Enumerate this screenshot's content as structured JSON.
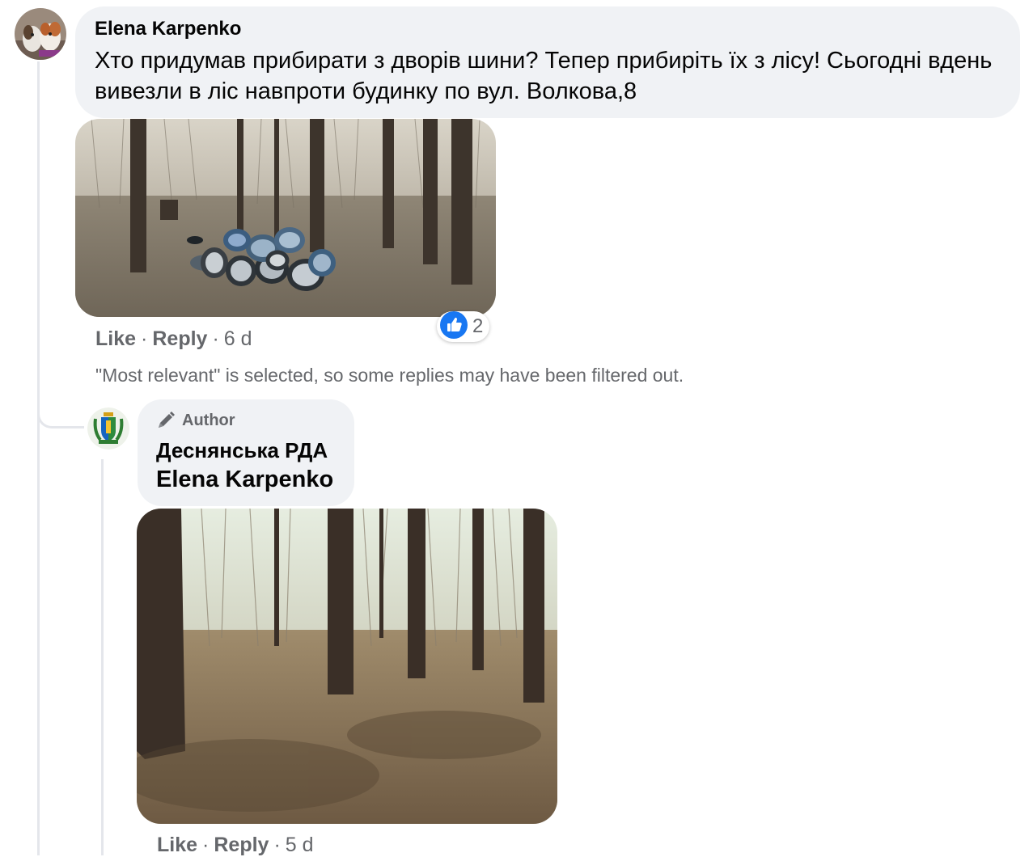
{
  "comment": {
    "author": "Elena Karpenko",
    "text": "Хто придумав прибирати з дворів шини? Тепер прибиріть їх з лісу! Сьогодні вдень вивезли в ліс навпроти будинку по вул. Волкова,8",
    "like_label": "Like",
    "reply_label": "Reply",
    "time": "6 d",
    "reaction_count": "2"
  },
  "notice": "\"Most relevant\" is selected, so some replies may have been filtered out.",
  "reply": {
    "badge": "Author",
    "page_name": "Деснянська РДА",
    "tagged_name": "Elena Karpenko",
    "like_label": "Like",
    "reply_label": "Reply",
    "time": "5 d"
  },
  "icons": {
    "reaction": "like-icon",
    "badge": "pen-icon"
  },
  "colors": {
    "bubble": "#f0f2f5",
    "like_blue": "#1877f2",
    "secondary_text": "#65676b"
  }
}
